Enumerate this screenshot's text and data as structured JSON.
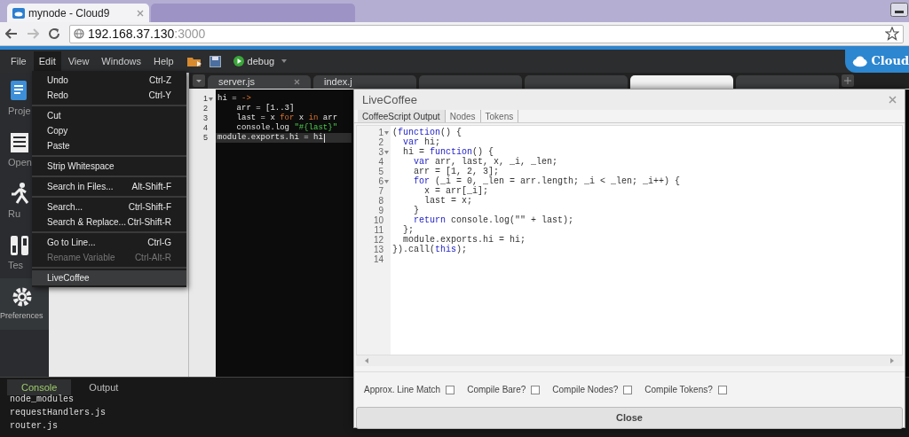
{
  "browser": {
    "tabs": [
      {
        "title": "mynode - Cloud9",
        "selected": true
      },
      {
        "selected": false
      }
    ],
    "address": {
      "host": "192.168.37.130",
      "port": ":3000"
    }
  },
  "menubar": {
    "items": [
      {
        "label": "File",
        "selected": false
      },
      {
        "label": "Edit",
        "selected": true
      },
      {
        "label": "View",
        "selected": false
      },
      {
        "label": "Windows",
        "selected": false
      },
      {
        "label": "Help",
        "selected": false
      }
    ],
    "run_config": "debug",
    "logo": "Cloud"
  },
  "sidebar": {
    "items": [
      {
        "label": "Proje",
        "kind": "project"
      },
      {
        "label": "Open",
        "kind": "open"
      },
      {
        "label": "Ru",
        "kind": "run"
      },
      {
        "label": "Tes",
        "kind": "test"
      },
      {
        "label": "Preferences",
        "kind": "preferences"
      }
    ]
  },
  "editor": {
    "tabs": [
      {
        "label": "server.js",
        "selected": false
      },
      {
        "label": "index.j",
        "selected": false
      },
      {
        "selected": false
      },
      {
        "selected": false
      },
      {
        "selected": true
      },
      {
        "selected": false
      }
    ],
    "lines": [
      {
        "number": "1",
        "foldable": true,
        "active": false,
        "segments": [
          {
            "text": "hi = ",
            "kind": "plain"
          },
          {
            "text": "->",
            "kind": "keyword"
          }
        ]
      },
      {
        "number": "2",
        "foldable": false,
        "active": false,
        "segments": [
          {
            "text": "    arr = [1..3]",
            "kind": "plain"
          }
        ]
      },
      {
        "number": "3",
        "foldable": false,
        "active": false,
        "segments": [
          {
            "text": "    last = x ",
            "kind": "plain"
          },
          {
            "text": "for",
            "kind": "keyword"
          },
          {
            "text": " x ",
            "kind": "plain"
          },
          {
            "text": "in",
            "kind": "keyword"
          },
          {
            "text": " arr",
            "kind": "plain"
          }
        ]
      },
      {
        "number": "4",
        "foldable": false,
        "active": false,
        "segments": [
          {
            "text": "    console.log ",
            "kind": "plain"
          },
          {
            "text": "\"#{last}\"",
            "kind": "string"
          }
        ]
      },
      {
        "number": "5",
        "foldable": false,
        "active": true,
        "segments": [
          {
            "text": "module.exports.hi = hi",
            "kind": "plain"
          }
        ]
      }
    ]
  },
  "edit_menu": {
    "groups": [
      [
        {
          "label": "Undo",
          "shortcut": "Ctrl-Z",
          "disabled": false,
          "highlighted": false
        },
        {
          "label": "Redo",
          "shortcut": "Ctrl-Y",
          "disabled": false,
          "highlighted": false
        }
      ],
      [
        {
          "label": "Cut",
          "disabled": false,
          "highlighted": false
        },
        {
          "label": "Copy",
          "disabled": false,
          "highlighted": false
        },
        {
          "label": "Paste",
          "disabled": false,
          "highlighted": false
        }
      ],
      [
        {
          "label": "Strip Whitespace",
          "disabled": false,
          "highlighted": false
        }
      ],
      [
        {
          "label": "Search in Files...",
          "shortcut": "Alt-Shift-F",
          "disabled": false,
          "highlighted": false
        }
      ],
      [
        {
          "label": "Search...",
          "shortcut": "Ctrl-Shift-F",
          "disabled": false,
          "highlighted": false
        },
        {
          "label": "Search & Replace...",
          "shortcut": "Ctrl-Shift-R",
          "disabled": false,
          "highlighted": false
        }
      ],
      [
        {
          "label": "Go to Line...",
          "shortcut": "Ctrl-G",
          "disabled": false,
          "highlighted": false
        },
        {
          "label": "Rename Variable",
          "shortcut": "Ctrl-Alt-R",
          "disabled": true,
          "highlighted": false
        }
      ],
      [
        {
          "label": "LiveCoffee",
          "disabled": false,
          "highlighted": true
        }
      ]
    ]
  },
  "console": {
    "tabs": [
      {
        "label": "Console",
        "selected": true
      },
      {
        "label": "Output",
        "selected": false
      }
    ],
    "lines": [
      "node_modules",
      "requestHandlers.js",
      "router.js"
    ]
  },
  "dialog": {
    "title": "LiveCoffee",
    "tabs": [
      {
        "label": "CoffeeScript Output",
        "selected": true
      },
      {
        "label": "Nodes",
        "selected": false
      },
      {
        "label": "Tokens",
        "selected": false
      }
    ],
    "lines": [
      {
        "number": "1",
        "foldable": true,
        "segments": [
          {
            "text": "(",
            "kind": "plain"
          },
          {
            "text": "function",
            "kind": "keyword"
          },
          {
            "text": "() {",
            "kind": "plain"
          }
        ]
      },
      {
        "number": "2",
        "foldable": false,
        "segments": [
          {
            "text": "  var",
            "kind": "keyword"
          },
          {
            "text": " hi;",
            "kind": "plain"
          }
        ]
      },
      {
        "number": "3",
        "foldable": true,
        "segments": [
          {
            "text": "  hi = ",
            "kind": "plain"
          },
          {
            "text": "function",
            "kind": "keyword"
          },
          {
            "text": "() {",
            "kind": "plain"
          }
        ]
      },
      {
        "number": "4",
        "foldable": false,
        "segments": [
          {
            "text": "    var",
            "kind": "keyword"
          },
          {
            "text": " arr, last, x, _i, _len;",
            "kind": "plain"
          }
        ]
      },
      {
        "number": "5",
        "foldable": false,
        "segments": [
          {
            "text": "    arr = [1, 2, 3];",
            "kind": "plain"
          }
        ]
      },
      {
        "number": "6",
        "foldable": true,
        "segments": [
          {
            "text": "    for",
            "kind": "keyword"
          },
          {
            "text": " (_i = 0, _len = arr.length; _i < _len; _i++) {",
            "kind": "plain"
          }
        ]
      },
      {
        "number": "7",
        "foldable": false,
        "segments": [
          {
            "text": "      x = arr[_i];",
            "kind": "plain"
          }
        ]
      },
      {
        "number": "8",
        "foldable": false,
        "segments": [
          {
            "text": "      last = x;",
            "kind": "plain"
          }
        ]
      },
      {
        "number": "9",
        "foldable": false,
        "segments": [
          {
            "text": "    }",
            "kind": "plain"
          }
        ]
      },
      {
        "number": "10",
        "foldable": false,
        "segments": [
          {
            "text": "    return",
            "kind": "keyword"
          },
          {
            "text": " console.log(\"\" + last);",
            "kind": "plain"
          }
        ]
      },
      {
        "number": "11",
        "foldable": false,
        "segments": [
          {
            "text": "  };",
            "kind": "plain"
          }
        ]
      },
      {
        "number": "12",
        "foldable": false,
        "segments": [
          {
            "text": "  module.exports.hi = hi;",
            "kind": "plain"
          }
        ]
      },
      {
        "number": "13",
        "foldable": false,
        "segments": [
          {
            "text": "}).call(",
            "kind": "plain"
          },
          {
            "text": "this",
            "kind": "keyword"
          },
          {
            "text": ");",
            "kind": "plain"
          }
        ]
      },
      {
        "number": "14",
        "foldable": false
      }
    ],
    "options": [
      {
        "label": "Approx. Line Match",
        "checked": false
      },
      {
        "label": "Compile Bare?",
        "checked": false
      },
      {
        "label": "Compile Nodes?",
        "checked": false
      },
      {
        "label": "Compile Tokens?",
        "checked": false
      }
    ],
    "button": "Close"
  }
}
